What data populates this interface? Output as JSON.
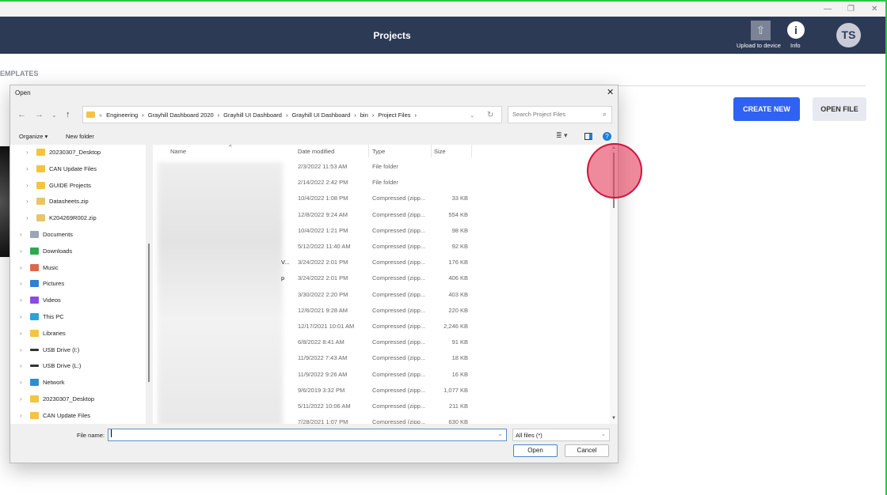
{
  "app": {
    "title": "Projects",
    "upload_label": "Upload to device",
    "info_label": "Info",
    "avatar": "TS",
    "section": "EMPLATES",
    "create_new": "CREATE NEW",
    "open_file": "OPEN FILE"
  },
  "dialog": {
    "title": "Open",
    "address": [
      "Engineering",
      "Grayhill Dashboard 2020",
      "Grayhill UI Dashboard",
      "Grayhill UI Dashboard",
      "bin",
      "Project Files"
    ],
    "search_placeholder": "Search Project Files",
    "organize": "Organize ▾",
    "new_folder": "New folder",
    "tree": [
      {
        "label": "20230307_Desktop",
        "icon": "folder",
        "indent": 1
      },
      {
        "label": "CAN Update Files",
        "icon": "folder",
        "indent": 1
      },
      {
        "label": "GUIDE Projects",
        "icon": "folder",
        "indent": 1
      },
      {
        "label": "Datasheets.zip",
        "icon": "zip-folder",
        "indent": 1
      },
      {
        "label": "K204269R002.zip",
        "icon": "zip-folder",
        "indent": 1
      },
      {
        "label": "Documents",
        "icon": "documents",
        "indent": 0
      },
      {
        "label": "Downloads",
        "icon": "downloads",
        "indent": 0
      },
      {
        "label": "Music",
        "icon": "music",
        "indent": 0
      },
      {
        "label": "Pictures",
        "icon": "pictures",
        "indent": 0
      },
      {
        "label": "Videos",
        "icon": "videos",
        "indent": 0
      },
      {
        "label": "This PC",
        "icon": "pc",
        "indent": 0
      },
      {
        "label": "Libraries",
        "icon": "folder",
        "indent": 0
      },
      {
        "label": "USB Drive (I:)",
        "icon": "drive",
        "indent": 0
      },
      {
        "label": "USB Drive (L:)",
        "icon": "drive",
        "indent": 0
      },
      {
        "label": "Network",
        "icon": "network",
        "indent": 0
      },
      {
        "label": "20230307_Desktop",
        "icon": "folder",
        "indent": 0
      },
      {
        "label": "CAN Update Files",
        "icon": "folder",
        "indent": 0
      }
    ],
    "columns": {
      "name": "Name",
      "date": "Date modified",
      "type": "Type",
      "size": "Size"
    },
    "files": [
      {
        "name": "",
        "date": "2/3/2022 11:53 AM",
        "type": "File folder",
        "size": ""
      },
      {
        "name": "",
        "date": "2/14/2022 2:42 PM",
        "type": "File folder",
        "size": ""
      },
      {
        "name": "",
        "date": "10/4/2022 1:08 PM",
        "type": "Compressed (zipp...",
        "size": "33 KB"
      },
      {
        "name": "",
        "date": "12/8/2022 9:24 AM",
        "type": "Compressed (zipp...",
        "size": "554 KB"
      },
      {
        "name": "",
        "date": "10/4/2022 1:21 PM",
        "type": "Compressed (zipp...",
        "size": "98 KB"
      },
      {
        "name": "",
        "date": "5/12/2022 11:40 AM",
        "type": "Compressed (zipp...",
        "size": "92 KB"
      },
      {
        "name": "V...",
        "date": "3/24/2022 2:01 PM",
        "type": "Compressed (zipp...",
        "size": "176 KB"
      },
      {
        "name": "p",
        "date": "3/24/2022 2:01 PM",
        "type": "Compressed (zipp...",
        "size": "406 KB"
      },
      {
        "name": "",
        "date": "3/30/2022 2:20 PM",
        "type": "Compressed (zipp...",
        "size": "403 KB"
      },
      {
        "name": "",
        "date": "12/6/2021 9:28 AM",
        "type": "Compressed (zipp...",
        "size": "220 KB"
      },
      {
        "name": "",
        "date": "12/17/2021 10:01 AM",
        "type": "Compressed (zipp...",
        "size": "2,246 KB"
      },
      {
        "name": "",
        "date": "6/8/2022 8:41 AM",
        "type": "Compressed (zipp...",
        "size": "91 KB"
      },
      {
        "name": "",
        "date": "11/9/2022 7:43 AM",
        "type": "Compressed (zipp...",
        "size": "18 KB"
      },
      {
        "name": "",
        "date": "11/9/2022 9:26 AM",
        "type": "Compressed (zipp...",
        "size": "16 KB"
      },
      {
        "name": "",
        "date": "9/6/2019 3:32 PM",
        "type": "Compressed (zipp...",
        "size": "1,077 KB"
      },
      {
        "name": "",
        "date": "5/11/2022 10:06 AM",
        "type": "Compressed (zipp...",
        "size": "211 KB"
      },
      {
        "name": "",
        "date": "7/28/2021 1:07 PM",
        "type": "Compressed (zipp...",
        "size": "630 KB"
      }
    ],
    "file_name_label": "File name:",
    "file_name_value": "",
    "file_type": "All files (*)",
    "open": "Open",
    "cancel": "Cancel"
  },
  "colors": {
    "header": "#2d3a56",
    "accent": "#2f62f2",
    "cursor": "#d0123e"
  }
}
